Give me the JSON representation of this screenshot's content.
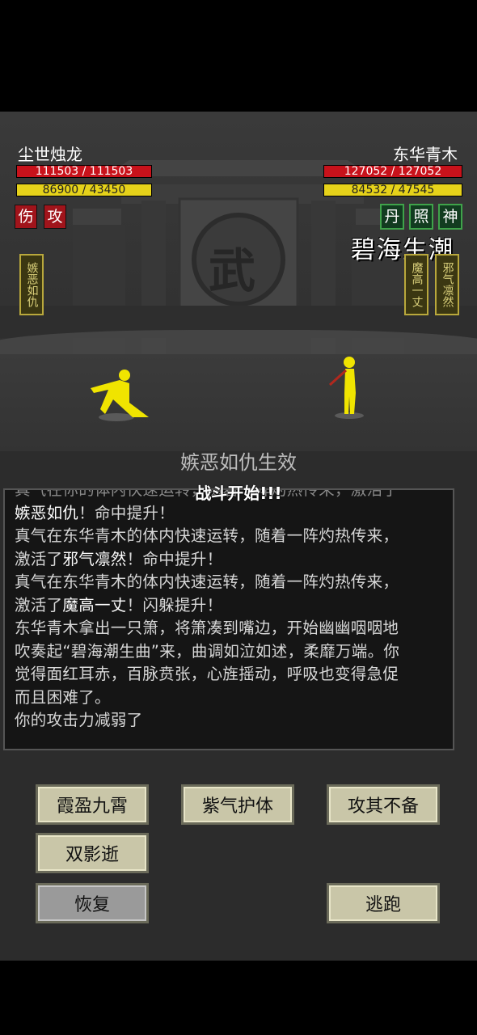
{
  "player": {
    "name": "尘世烛龙",
    "hp": "111503 / 111503",
    "hp_fill": 1.0,
    "mp": "86900 / 43450",
    "mp_fill": 1.0,
    "status": [
      "伤",
      "攻"
    ],
    "scroll": "嫉恶如仇"
  },
  "enemy": {
    "name": "东华青木",
    "hp": "127052 / 127052",
    "hp_fill": 1.0,
    "mp": "84532 / 47545",
    "mp_fill": 1.0,
    "status": [
      "丹",
      "照",
      "神"
    ],
    "skill": "碧海生潮",
    "scrolls": [
      "魔高一丈",
      "邪气凛然"
    ]
  },
  "scene": {
    "gate_char": "武",
    "float_text": "嫉恶如仇生效",
    "start_text": "战斗开始!!!"
  },
  "log": {
    "partial": "真气在你的体内快速运转，随着一阵灼热传来，激活了",
    "l1a": "嫉恶如仇",
    "l1b": "！命中提升！",
    "l2": "真气在东华青木的体内快速运转，随着一阵灼热传来，",
    "l3a": "激活了",
    "l3b": "邪气凛然",
    "l3c": "！命中提升！",
    "l4": "真气在东华青木的体内快速运转，随着一阵灼热传来，",
    "l5a": "激活了",
    "l5b": "魔高一丈",
    "l5c": "！闪躲提升！",
    "l6": "东华青木拿出一只箫，将箫凑到嘴边，开始幽幽咽咽地",
    "l7": "吹奏起“碧海潮生曲”来，曲调如泣如述，柔靡万端。你",
    "l8": "觉得面红耳赤，百脉贲张，心旌摇动，呼吸也变得急促",
    "l9": "而且困难了。",
    "l10": "你的攻击力减弱了"
  },
  "buttons": {
    "b1": "霞盈九霄",
    "b2": "紫气护体",
    "b3": "攻其不备",
    "b4": "双影逝",
    "b5": "恢复",
    "b6": "逃跑"
  }
}
